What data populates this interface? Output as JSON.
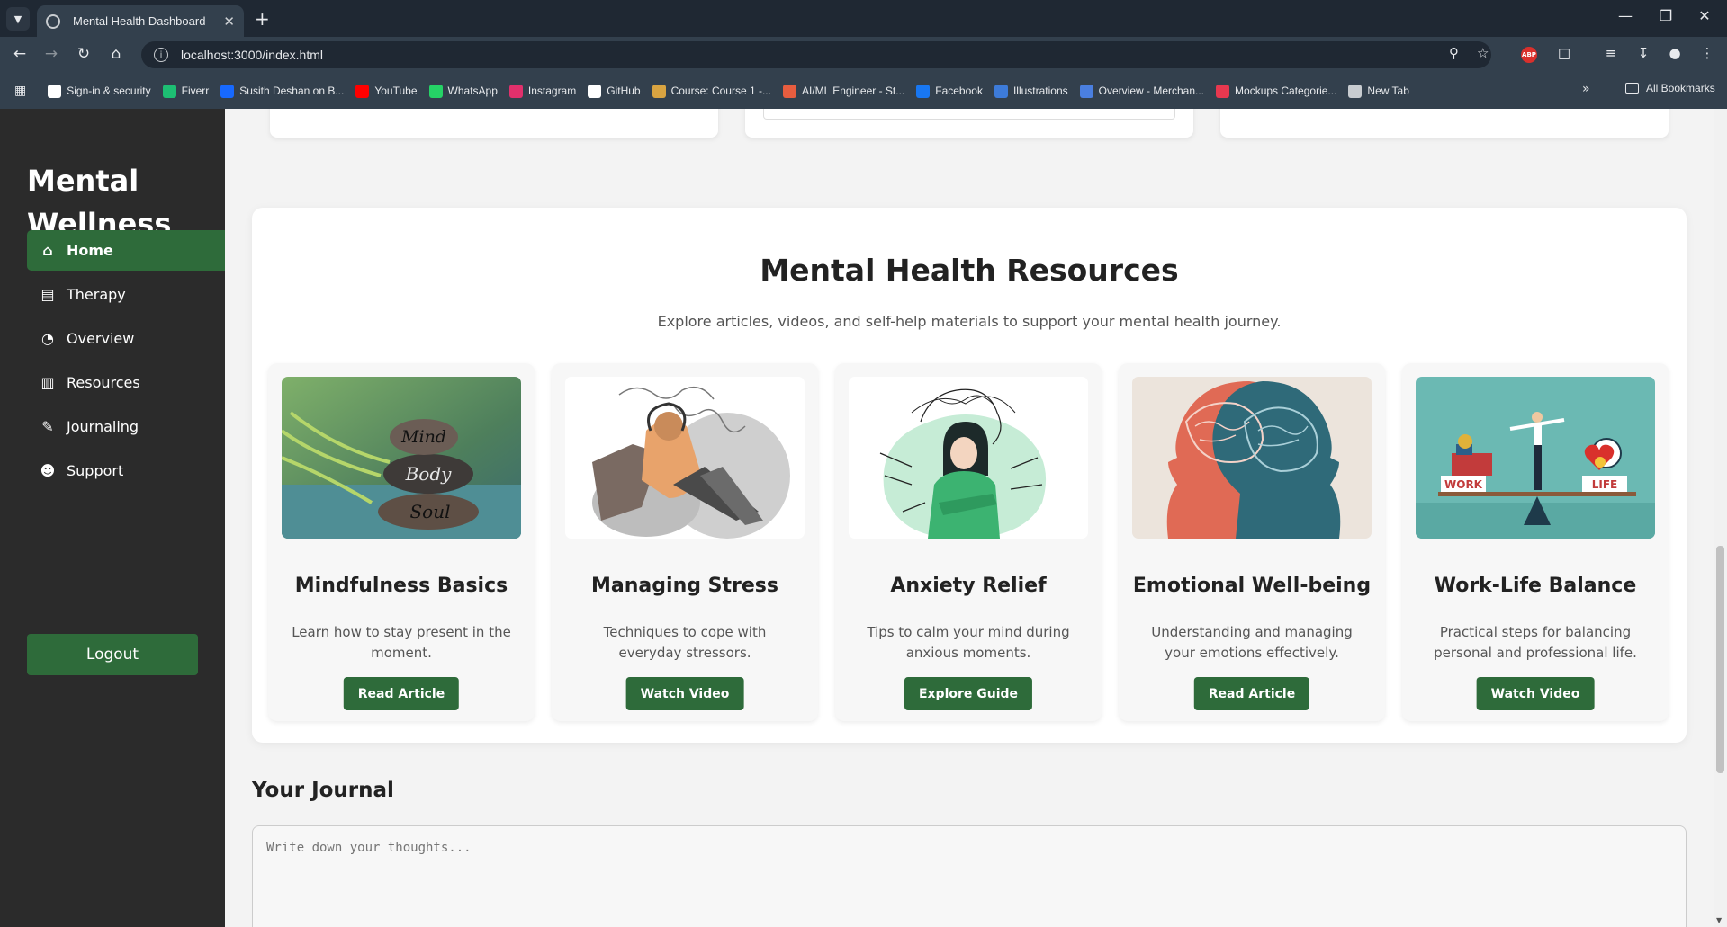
{
  "browser": {
    "tab_title": "Mental Health Dashboard",
    "url": "localhost:3000/index.html",
    "bookmarks": [
      {
        "label": "Sign-in & security",
        "icon": "google-icon",
        "color": "#ffffff"
      },
      {
        "label": "Fiverr",
        "icon": "fiverr-icon",
        "color": "#1dbf73"
      },
      {
        "label": "Susith Deshan on B...",
        "icon": "behance-icon",
        "color": "#1769ff"
      },
      {
        "label": "YouTube",
        "icon": "youtube-icon",
        "color": "#ff0000"
      },
      {
        "label": "WhatsApp",
        "icon": "whatsapp-icon",
        "color": "#25d366"
      },
      {
        "label": "Instagram",
        "icon": "instagram-icon",
        "color": "#e1306c"
      },
      {
        "label": "GitHub",
        "icon": "github-icon",
        "color": "#ffffff"
      },
      {
        "label": "Course: Course 1 -...",
        "icon": "course-icon",
        "color": "#d9a441"
      },
      {
        "label": "AI/ML Engineer - St...",
        "icon": "aiml-icon",
        "color": "#e85d3f"
      },
      {
        "label": "Facebook",
        "icon": "facebook-icon",
        "color": "#1877f2"
      },
      {
        "label": "Illustrations",
        "icon": "illustrations-icon",
        "color": "#3d7bd9"
      },
      {
        "label": "Overview - Merchan...",
        "icon": "merch-icon",
        "color": "#4a7fe0"
      },
      {
        "label": "Mockups Categorie...",
        "icon": "mockups-icon",
        "color": "#e8384f"
      },
      {
        "label": "New Tab",
        "icon": "globe-icon",
        "color": "#c8ccd0"
      }
    ],
    "all_bookmarks_label": "All Bookmarks"
  },
  "sidebar": {
    "brand": "Mental Wellness",
    "items": [
      {
        "label": "Home",
        "icon": "home-icon",
        "active": true
      },
      {
        "label": "Therapy",
        "icon": "calendar-icon",
        "active": false
      },
      {
        "label": "Overview",
        "icon": "pie-chart-icon",
        "active": false
      },
      {
        "label": "Resources",
        "icon": "book-icon",
        "active": false
      },
      {
        "label": "Journaling",
        "icon": "pencil-icon",
        "active": false
      },
      {
        "label": "Support",
        "icon": "users-icon",
        "active": false
      }
    ],
    "logout_label": "Logout"
  },
  "resources": {
    "title": "Mental Health Resources",
    "subtitle": "Explore articles, videos, and self-help materials to support your mental health journey.",
    "cards": [
      {
        "title": "Mindfulness Basics",
        "description": "Learn how to stay present in the moment.",
        "button": "Read Article",
        "image_text": [
          "Mind",
          "Body",
          "Soul"
        ]
      },
      {
        "title": "Managing Stress",
        "description": "Techniques to cope with everyday stressors.",
        "button": "Watch Video"
      },
      {
        "title": "Anxiety Relief",
        "description": "Tips to calm your mind during anxious moments.",
        "button": "Explore Guide"
      },
      {
        "title": "Emotional Well-being",
        "description": "Understanding and managing your emotions effectively.",
        "button": "Read Article"
      },
      {
        "title": "Work-Life Balance",
        "description": "Practical steps for balancing personal and professional life.",
        "button": "Watch Video",
        "image_text": [
          "WORK",
          "LIFE"
        ]
      }
    ]
  },
  "journal": {
    "title": "Your Journal",
    "placeholder": "Write down your thoughts..."
  },
  "colors": {
    "accent_green": "#2e6b3a",
    "sidebar_bg": "#2b2b2b",
    "chrome_bg": "#1f2833"
  }
}
